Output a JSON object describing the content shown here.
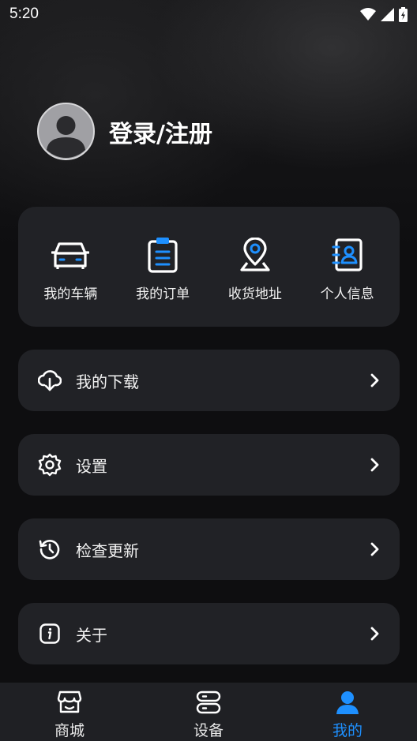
{
  "status_bar": {
    "time": "5:20"
  },
  "profile": {
    "login_label": "登录/注册"
  },
  "quick_actions": [
    {
      "label": "我的车辆",
      "icon": "car-icon"
    },
    {
      "label": "我的订单",
      "icon": "clipboard-icon"
    },
    {
      "label": "收货地址",
      "icon": "location-pin-icon"
    },
    {
      "label": "个人信息",
      "icon": "contact-book-icon"
    }
  ],
  "menu": [
    {
      "label": "我的下载",
      "icon": "cloud-download-icon"
    },
    {
      "label": "设置",
      "icon": "gear-icon"
    },
    {
      "label": "检查更新",
      "icon": "history-icon"
    },
    {
      "label": "关于",
      "icon": "info-icon"
    }
  ],
  "bottom_nav": [
    {
      "label": "商城",
      "icon": "store-icon",
      "active": false
    },
    {
      "label": "设备",
      "icon": "device-icon",
      "active": false
    },
    {
      "label": "我的",
      "icon": "user-icon",
      "active": true
    }
  ],
  "colors": {
    "accent": "#1e90ff",
    "card": "#212226",
    "background": "#0e0e10"
  }
}
